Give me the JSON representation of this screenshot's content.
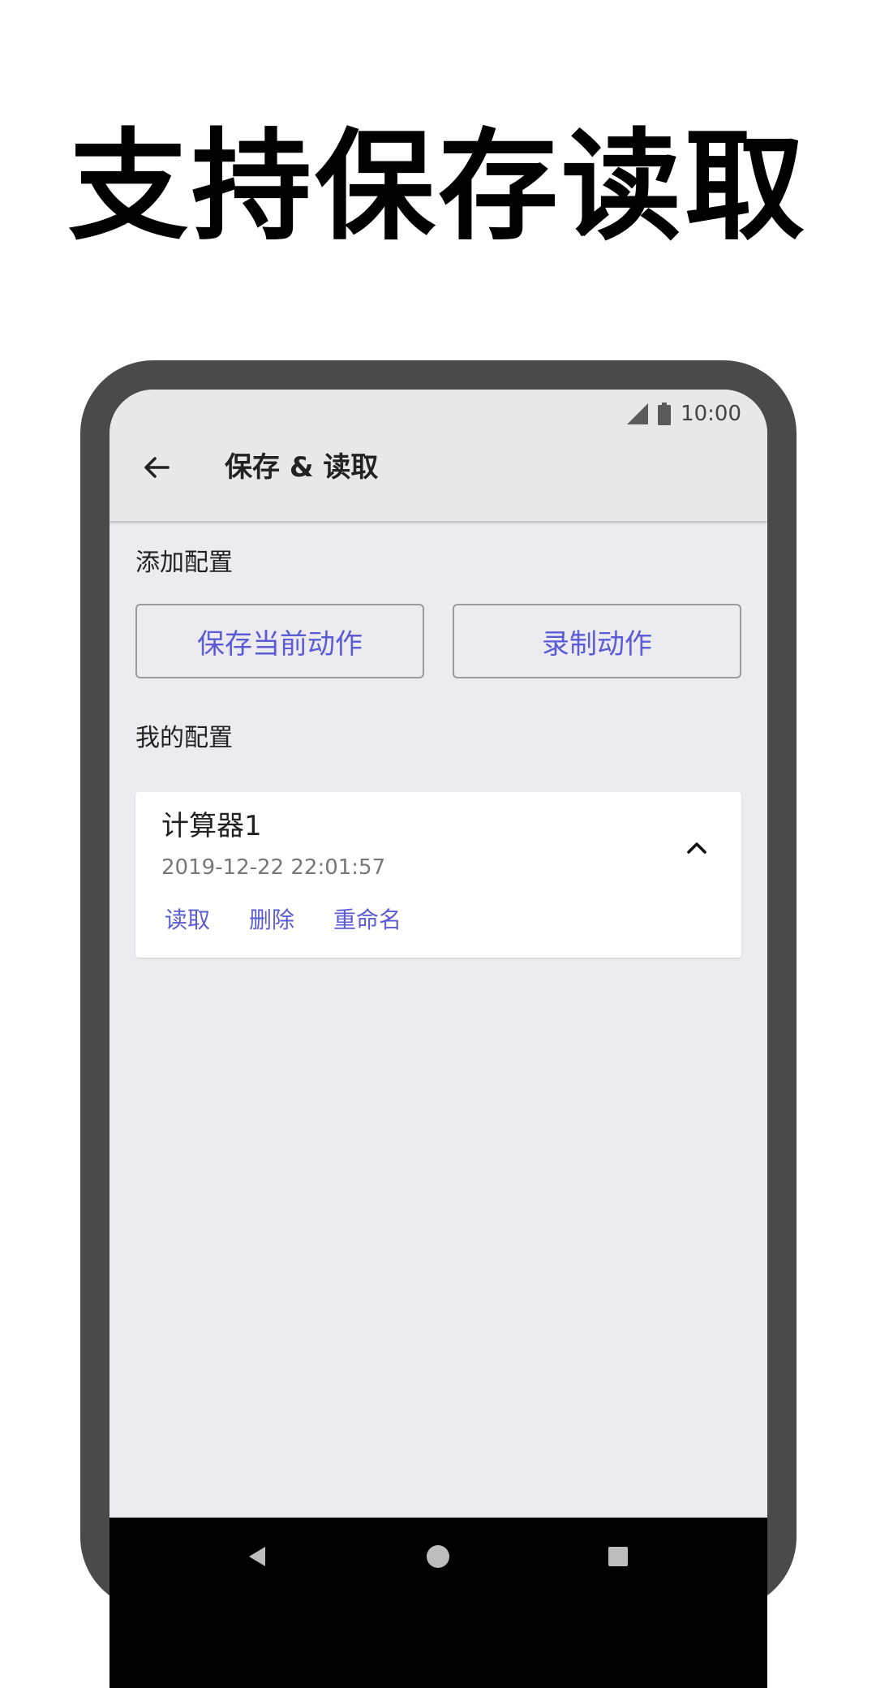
{
  "headline": "支持保存读取",
  "status_bar": {
    "time": "10:00"
  },
  "appbar": {
    "title": "保存 & 读取"
  },
  "add_section": {
    "label": "添加配置",
    "save_current_button": "保存当前动作",
    "record_button": "录制动作"
  },
  "my_section": {
    "label": "我的配置",
    "items": [
      {
        "name": "计算器1",
        "timestamp": "2019-12-22 22:01:57",
        "actions": {
          "load": "读取",
          "delete": "删除",
          "rename": "重命名"
        }
      }
    ]
  },
  "colors": {
    "accent": "#5b5bd6",
    "appbar_bg": "#e8e8e8",
    "screen_bg": "#ebebf0",
    "phone_frame": "#4a4a4a"
  },
  "icons": {
    "back": "arrow-left-icon",
    "collapse": "chevron-up-icon",
    "signal": "signal-icon",
    "battery": "battery-icon"
  }
}
